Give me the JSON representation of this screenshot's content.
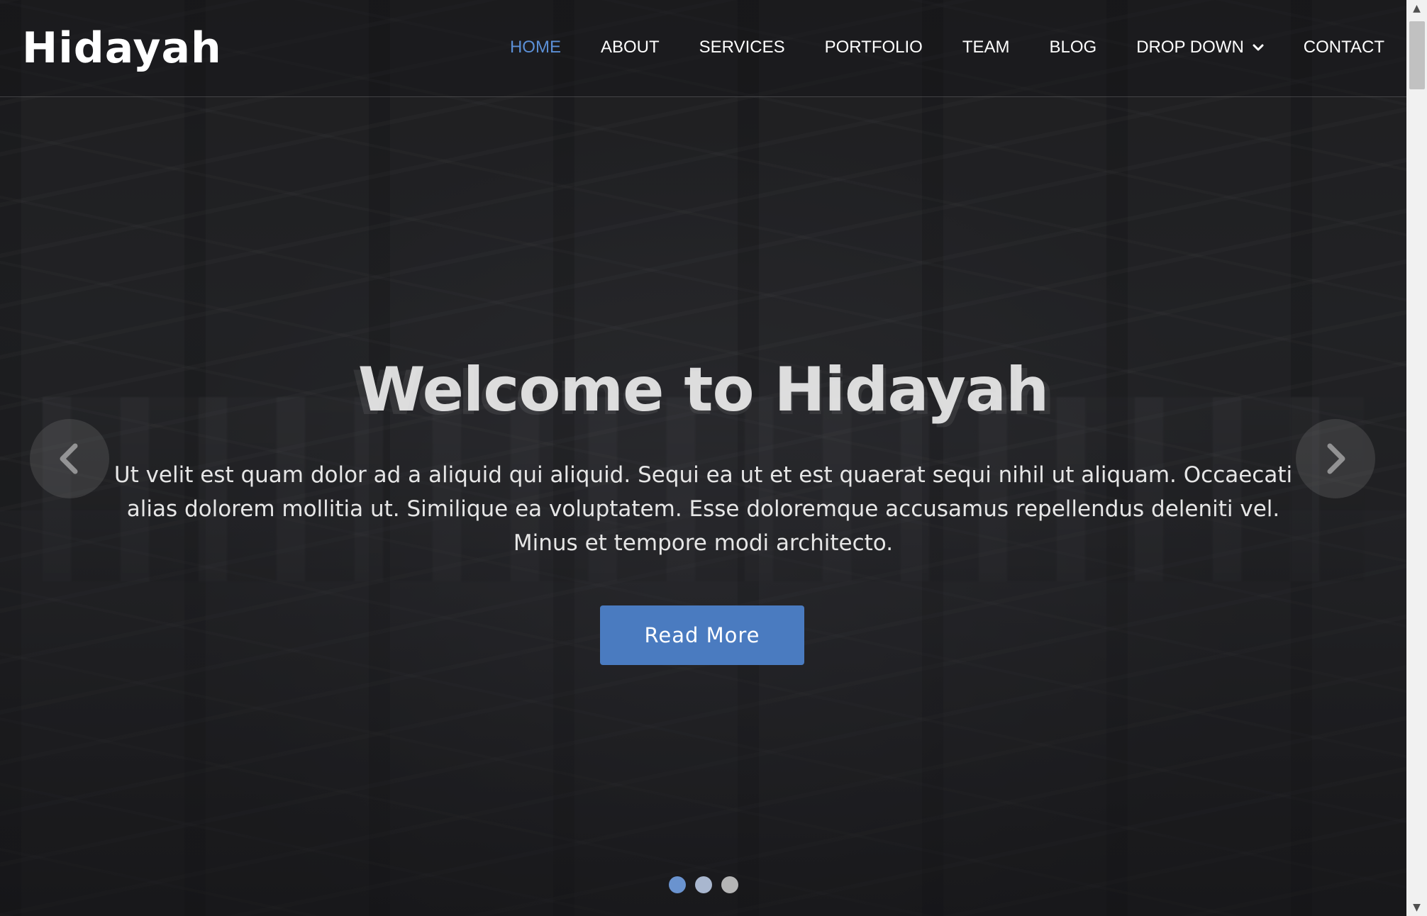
{
  "brand": {
    "logo": "Hidayah"
  },
  "nav": {
    "items": [
      {
        "label": "HOME",
        "active": true
      },
      {
        "label": "ABOUT"
      },
      {
        "label": "SERVICES"
      },
      {
        "label": "PORTFOLIO"
      },
      {
        "label": "TEAM"
      },
      {
        "label": "BLOG"
      },
      {
        "label": "DROP DOWN",
        "has_dropdown": true
      },
      {
        "label": "CONTACT"
      }
    ]
  },
  "hero": {
    "title": "Welcome to Hidayah",
    "text": "Ut velit est quam dolor ad a aliquid qui aliquid. Sequi ea ut et est quaerat sequi nihil ut aliquam. Occaecati alias dolorem mollitia ut. Similique ea voluptatem. Esse doloremque accusamus repellendus deleniti vel. Minus et tempore modi architecto.",
    "button": "Read More"
  },
  "carousel": {
    "slides": 3,
    "active_index": 0,
    "prev_icon": "chevron-left-icon",
    "next_icon": "chevron-right-icon"
  },
  "colors": {
    "accent": "#5b8fd6",
    "button": "#4a7bc0",
    "text": "#ffffff"
  }
}
